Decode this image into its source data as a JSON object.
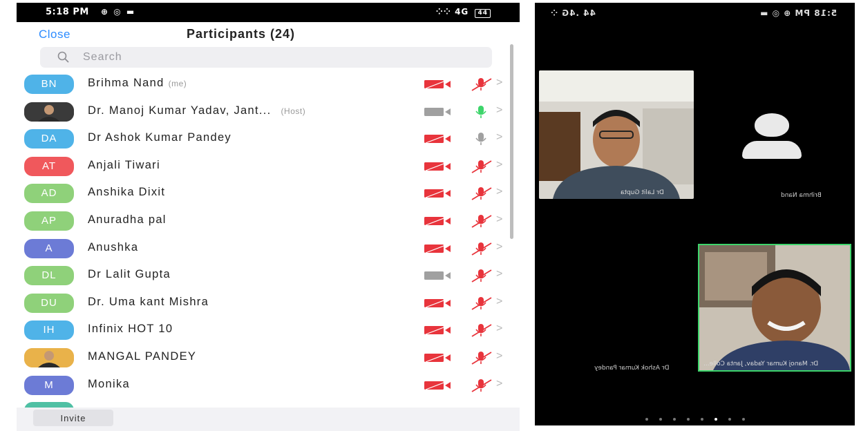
{
  "left_status": {
    "time": "5:18 PM",
    "icons": "⊕ ◎ ▬",
    "signal": "4G",
    "battery": "44"
  },
  "header": {
    "close_label": "Close",
    "title": "Participants (24)"
  },
  "search": {
    "placeholder": "Search"
  },
  "participants": [
    {
      "initials": "BN",
      "name": "Brihma Nand",
      "tag": "(me)",
      "avatar_color": "#4fb3e8",
      "camera": "off",
      "mic": "muted"
    },
    {
      "initials": "",
      "name": "Dr. Manoj Kumar Yadav, Jant...",
      "tag": "(Host)",
      "avatar_color": "#3a3a3a",
      "camera": "on",
      "mic": "active"
    },
    {
      "initials": "DA",
      "name": "Dr Ashok Kumar Pandey",
      "tag": "",
      "avatar_color": "#4fb3e8",
      "camera": "off",
      "mic": "idle"
    },
    {
      "initials": "AT",
      "name": "Anjali Tiwari",
      "tag": "",
      "avatar_color": "#f0585c",
      "camera": "off",
      "mic": "muted"
    },
    {
      "initials": "AD",
      "name": "Anshika Dixit",
      "tag": "",
      "avatar_color": "#8fd17a",
      "camera": "off",
      "mic": "muted"
    },
    {
      "initials": "AP",
      "name": "Anuradha pal",
      "tag": "",
      "avatar_color": "#8fd17a",
      "camera": "off",
      "mic": "muted"
    },
    {
      "initials": "A",
      "name": "Anushka",
      "tag": "",
      "avatar_color": "#6c7bd6",
      "camera": "off",
      "mic": "muted"
    },
    {
      "initials": "DL",
      "name": "Dr Lalit Gupta",
      "tag": "",
      "avatar_color": "#8fd17a",
      "camera": "on",
      "mic": "muted"
    },
    {
      "initials": "DU",
      "name": "Dr. Uma kant Mishra",
      "tag": "",
      "avatar_color": "#8fd17a",
      "camera": "off",
      "mic": "muted"
    },
    {
      "initials": "IH",
      "name": "Infinix HOT 10",
      "tag": "",
      "avatar_color": "#4fb3e8",
      "camera": "off",
      "mic": "muted"
    },
    {
      "initials": "",
      "name": "MANGAL PANDEY",
      "tag": "",
      "avatar_color": "#e9b24a",
      "camera": "off",
      "mic": "muted"
    },
    {
      "initials": "M",
      "name": "Monika",
      "tag": "",
      "avatar_color": "#6c7bd6",
      "camera": "off",
      "mic": "muted"
    }
  ],
  "footer": {
    "invite_label": "Invite"
  },
  "right_status": {
    "left_text": "44 .4G ⁘",
    "right_text": "5:18 PM ⊕ ◎ ▬"
  },
  "video_tiles": {
    "tile1_name": "Dr Lalit Gupta",
    "self_name": "Brihma Nand",
    "speaker_name": "Dr. Manoj Kumar Yadav, Janta Colle...",
    "other_name": "Dr Ashok Kumar Pandey"
  },
  "colors": {
    "accent": "#2d8cff",
    "muted_red": "#e8343c",
    "active_green": "#3dd56b",
    "idle_grey": "#a0a0a0"
  },
  "page_dots": {
    "count": 8,
    "active": 5
  }
}
